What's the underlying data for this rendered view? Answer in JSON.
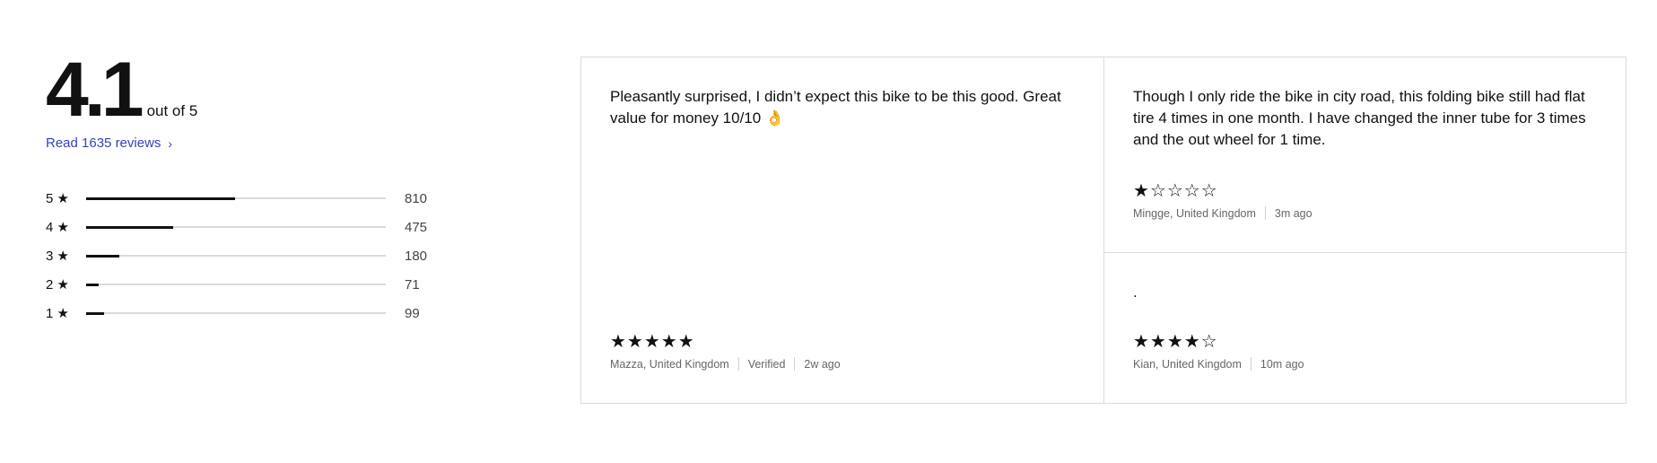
{
  "summary": {
    "score": "4.1",
    "out_of": "out of 5",
    "read_reviews": "Read 1635 reviews",
    "distribution": [
      {
        "label": "5 ★",
        "count": "810",
        "fraction": 0.496
      },
      {
        "label": "4 ★",
        "count": "475",
        "fraction": 0.291
      },
      {
        "label": "3 ★",
        "count": "180",
        "fraction": 0.11
      },
      {
        "label": "2 ★",
        "count": "71",
        "fraction": 0.043
      },
      {
        "label": "1 ★",
        "count": "99",
        "fraction": 0.061
      }
    ]
  },
  "reviews": [
    {
      "text": "Pleasantly surprised, I didn’t expect this bike to be this good. Great value for money 10/10 👌",
      "rating": 5,
      "stars": "★★★★★",
      "author": "Mazza, United Kingdom",
      "verified": "Verified",
      "time": "2w ago"
    },
    {
      "text": "Though I only ride the bike in city road, this folding bike still had flat tire 4 times in one month. I have changed the inner tube for 3 times and the out wheel for 1 time.",
      "rating": 1,
      "stars": "★☆☆☆☆",
      "author": "Mingge, United Kingdom",
      "time": "3m ago"
    },
    {
      "text": ".",
      "rating": 4,
      "stars": "★★★★☆",
      "author": "Kian, United Kingdom",
      "time": "10m ago"
    }
  ]
}
